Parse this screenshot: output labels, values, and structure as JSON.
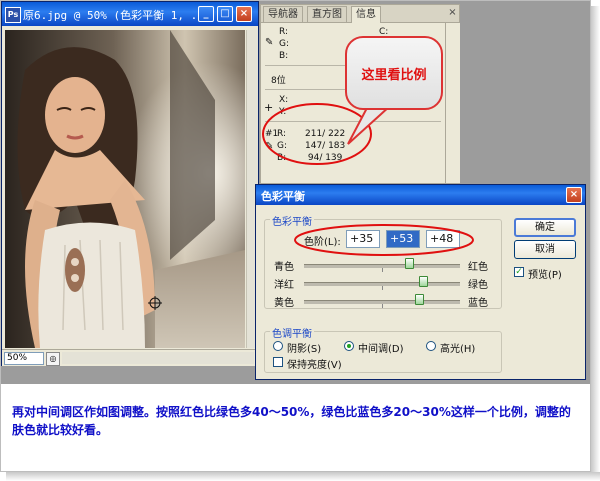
{
  "image_window": {
    "app_icon": "Ps",
    "title": "原6.jpg @ 50% (色彩平衡 1, ...",
    "zoom": "50%",
    "buttons": {
      "minimize": "_",
      "maximize": "□",
      "close": "×"
    }
  },
  "info_panel": {
    "tabs": [
      {
        "label": "导航器"
      },
      {
        "label": "直方图"
      },
      {
        "label": "信息"
      }
    ],
    "close": "×",
    "rgb_labels": {
      "r": "R:",
      "g": "G:",
      "b": "B:"
    },
    "c_label": "C:",
    "bits": "8位",
    "x_label": "X:",
    "y_label": "Y:",
    "sample": {
      "marker": "#1",
      "r": {
        "label": "R:",
        "value": "211/ 222"
      },
      "g": {
        "label": "G:",
        "value": "147/ 183"
      },
      "b": {
        "label": "B:",
        "value": " 94/ 139"
      }
    }
  },
  "callout": {
    "text": "这里看比例",
    "color": "#e01010"
  },
  "dialog": {
    "title": "色彩平衡",
    "close": "×",
    "balance_group": {
      "legend": "色彩平衡",
      "levels_label": "色阶(L):",
      "levels": [
        "+35",
        "+53",
        "+48"
      ],
      "sliders": [
        {
          "left": "青色",
          "right": "红色",
          "value": 35
        },
        {
          "left": "洋红",
          "right": "绿色",
          "value": 53
        },
        {
          "left": "黄色",
          "right": "蓝色",
          "value": 48
        }
      ]
    },
    "tone_group": {
      "legend": "色调平衡",
      "options": [
        {
          "label": "阴影(S)",
          "selected": false
        },
        {
          "label": "中间调(D)",
          "selected": true
        },
        {
          "label": "高光(H)",
          "selected": false
        }
      ],
      "preserve_luminosity": {
        "label": "保持亮度(V)",
        "checked": false
      }
    },
    "ok": "确定",
    "cancel": "取消",
    "preview": {
      "label": "预览(P)",
      "checked": true
    }
  },
  "caption": "再对中间调区作如图调整。按照红色比绿色多40～50%，绿色比蓝色多20～30%这样一个比例，调整的肤色就比较好看。",
  "colors": {
    "title_bar": "#0a5bd8",
    "caption": "#1010c8",
    "accent_red": "#e01010"
  }
}
